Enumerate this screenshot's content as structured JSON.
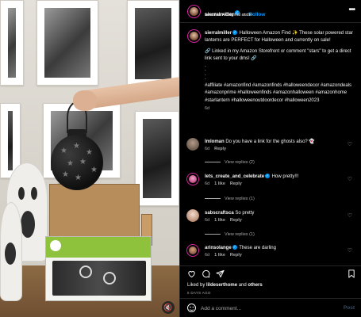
{
  "header": {
    "username": "sierralmiller",
    "follow_label": "Follow",
    "separator": "•",
    "audio": "ianasher • Original audio",
    "more_icon": "more-horizontal-icon"
  },
  "caption": {
    "username": "sierralmiller",
    "text_intro": "Halloween Amazon Find ✨ These solar powered star lanterns are PERFECT for Halloween and currently on sale!",
    "text_link": "🔗 Linked in my Amazon Storefront or comment \"stars\" to get a direct link sent to your dms! 🔗",
    "dots": ".\n.\n.\n.",
    "hashtags": "#affiliate #amazonfind #amazonfinds #halloweendecor #amazondeals #amazonprime #halloweenfinds #amazonhalloween #amazonhome #starlantern #halloweenoutdoordecor #halloween2023",
    "time": "6d"
  },
  "comments": [
    {
      "username": "lmloman",
      "text": "Do you have a link for the ghosts also? 👻",
      "time": "6d",
      "likes": "",
      "reply": "Reply",
      "view_replies": "View replies (2)",
      "avatar_color": "#6b5a4e",
      "ring": false,
      "verified": false
    },
    {
      "username": "lets_create_and_celebrate",
      "text": "How pretty!!!",
      "time": "6d",
      "likes": "1 like",
      "reply": "Reply",
      "view_replies": "View replies (1)",
      "avatar_color": "#c24a84",
      "ring": true,
      "verified": true
    },
    {
      "username": "sabscraftsca",
      "text": "So pretty",
      "time": "6d",
      "likes": "1 like",
      "reply": "Reply",
      "view_replies": "View replies (1)",
      "avatar_color": "#d7b8a6",
      "ring": false,
      "verified": false
    },
    {
      "username": "arinsolange",
      "text": "These are darling",
      "time": "6d",
      "likes": "1 like",
      "reply": "Reply",
      "view_replies": "",
      "avatar_color": "#8a5a45",
      "ring": true,
      "verified": true
    }
  ],
  "actions": {
    "like_icon": "heart-icon",
    "comment_icon": "comment-icon",
    "share_icon": "send-icon",
    "save_icon": "bookmark-icon"
  },
  "likes": {
    "prefix": "Liked by ",
    "user": "lildeserthome",
    "suffix": " and ",
    "others": "others"
  },
  "date": "6 DAYS AGO",
  "add_comment": {
    "placeholder": "Add a comment...",
    "post_label": "Post",
    "emoji_icon": "smiley-icon"
  },
  "media": {
    "mute_icon": "speaker-muted-icon",
    "mute_glyph": "🔇"
  },
  "colors": {
    "accent": "#0095f6",
    "background": "#000000",
    "muted": "#a8a8a8",
    "story_ring": "#d6249f"
  }
}
